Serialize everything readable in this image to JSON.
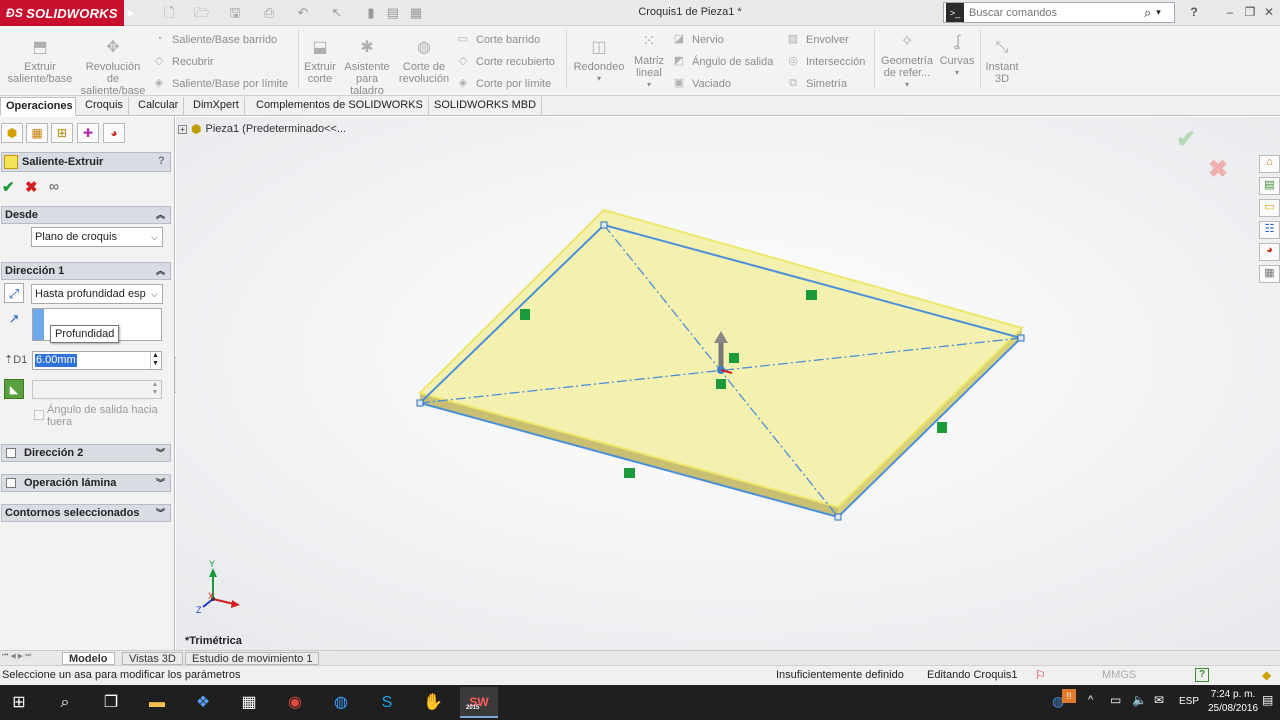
{
  "titlebar": {
    "brand": "SOLIDWORKS",
    "document_title": "Croquis1 de Pieza1 *",
    "search_placeholder": "Buscar comandos",
    "help": "?"
  },
  "ribbon": {
    "big_buttons": [
      {
        "label": "Extruir\nsaliente/base",
        "icon": "extrude-boss-icon"
      },
      {
        "label": "Revolución\nde\nsaliente/base",
        "icon": "revolve-boss-icon"
      },
      {
        "label": "Extruir\ncorte",
        "icon": "extrude-cut-icon"
      },
      {
        "label": "Asistente\npara\ntaladro",
        "icon": "hole-wizard-icon"
      },
      {
        "label": "Corte de\nrevolución",
        "icon": "revolve-cut-icon"
      },
      {
        "label": "Redondeo",
        "icon": "fillet-icon"
      },
      {
        "label": "Matriz\nlineal",
        "icon": "linear-pattern-icon"
      },
      {
        "label": "Geometría\nde refer...",
        "icon": "reference-geometry-icon"
      },
      {
        "label": "Curvas",
        "icon": "curves-icon"
      },
      {
        "label": "Instant\n3D",
        "icon": "instant3d-icon"
      }
    ],
    "small_buttons": [
      "Saliente/Base barrido",
      "Recubrir",
      "Saliente/Base por límite",
      "Corte barrido",
      "Corte recubierto",
      "Corte por límite",
      "Nervio",
      "Ángulo de salida",
      "Vaciado",
      "Envolver",
      "Intersección",
      "Simetría"
    ]
  },
  "tabs": [
    "Operaciones",
    "Croquis",
    "Calcular",
    "DimXpert",
    "Complementos de SOLIDWORKS",
    "SOLIDWORKS MBD"
  ],
  "property_manager": {
    "title": "Saliente-Extruir",
    "help": "?",
    "from_section": {
      "label": "Desde",
      "value": "Plano de croquis"
    },
    "direction1": {
      "label": "Dirección 1",
      "end_condition": "Hasta profundidad esp",
      "tooltip": "Profundidad",
      "depth": "6.00mm",
      "draft_label": "Ángulo de salida hacia fuera"
    },
    "direction2": "Dirección 2",
    "thin_feature": "Operación lámina",
    "selected_contours": "Contornos seleccionados"
  },
  "viewport": {
    "tree_item": "Pieza1  (Predeterminado<<...",
    "view_name": "*Trimétrica",
    "axis_labels": {
      "x": "X",
      "y": "Y",
      "z": "Z"
    }
  },
  "bottom_tabs": [
    "Modelo",
    "Vistas 3D",
    "Estudio de movimiento 1"
  ],
  "status": {
    "message": "Seleccione un asa para modificar los parámetros",
    "definition": "Insuficientemente definido",
    "editing": "Editando Croquis1",
    "units": "MMGS",
    "help": "?"
  },
  "taskbar": {
    "language": "ESP",
    "time": "7:24 p. m.",
    "date": "25/08/2016",
    "sw_badge": "2015"
  },
  "colors": {
    "brand_red": "#c8102e",
    "plate_fill": "#f4f1b0",
    "plate_edge": "#e6e060",
    "sketch_blue": "#4a90d9",
    "relation_green": "#1a9a3a"
  }
}
